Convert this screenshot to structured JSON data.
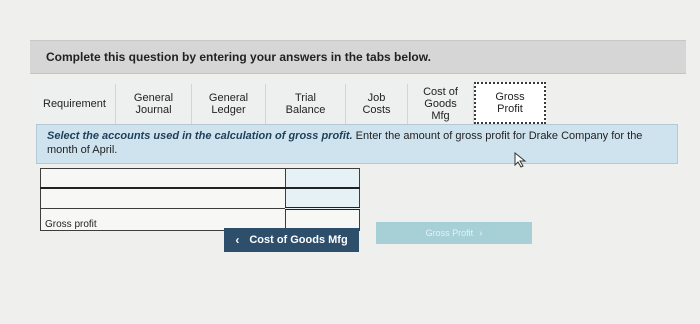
{
  "instruction": "Complete this question by entering your answers in the tabs below.",
  "tabs": [
    {
      "label": "Requirement",
      "active": false
    },
    {
      "label": "General Journal",
      "active": false
    },
    {
      "label": "General Ledger",
      "active": false
    },
    {
      "label": "Trial Balance",
      "active": false
    },
    {
      "label": "Job Costs",
      "active": false
    },
    {
      "label": "Cost of Goods Mfg",
      "active": false
    },
    {
      "label": "Gross Profit",
      "active": true
    }
  ],
  "question": {
    "emphasis": "Select the accounts used in the calculation of gross profit.",
    "rest": " Enter the amount of gross profit for Drake Company for the month of April."
  },
  "table": {
    "rows": [
      {
        "label": "",
        "value": ""
      },
      {
        "label": "",
        "value": ""
      }
    ],
    "result": {
      "label": "Gross profit",
      "value": ""
    }
  },
  "navigation": {
    "prev_label": "Cost of Goods Mfg",
    "next_label": "Gross Profit"
  },
  "colors": {
    "prev_button": "#2d4f6c",
    "next_button_disabled": "#a6cfd6",
    "question_panel": "#cfe3ee"
  },
  "icons": {
    "prev": "chevron-left-icon",
    "next": "chevron-right-icon",
    "pointer": "mouse-cursor-icon"
  }
}
